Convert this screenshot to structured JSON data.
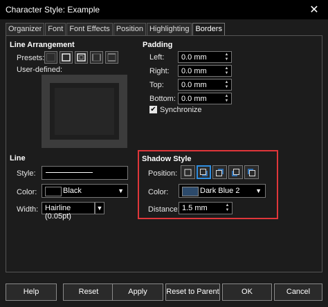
{
  "window": {
    "title": "Character Style: Example",
    "close_glyph": "✕"
  },
  "tabs": [
    "Organizer",
    "Font",
    "Font Effects",
    "Position",
    "Highlighting",
    "Borders"
  ],
  "line_arrangement": {
    "heading": "Line Arrangement",
    "presets_label": "Presets:",
    "user_defined_label": "User-defined:"
  },
  "padding": {
    "heading": "Padding",
    "left_label": "Left:",
    "left_value": "0.0 mm",
    "right_label": "Right:",
    "right_value": "0.0 mm",
    "top_label": "Top:",
    "top_value": "0.0 mm",
    "bottom_label": "Bottom:",
    "bottom_value": "0.0 mm",
    "sync_label": "Synchronize",
    "sync_checked": true
  },
  "line": {
    "heading": "Line",
    "style_label": "Style:",
    "color_label": "Color:",
    "color_value": "Black",
    "width_label": "Width:",
    "width_value": "Hairline (0.05pt)"
  },
  "shadow": {
    "heading": "Shadow Style",
    "position_label": "Position:",
    "color_label": "Color:",
    "color_value": "Dark Blue 2",
    "color_swatch": "#2c4a6b",
    "distance_label": "Distance:",
    "distance_value": "1.5 mm",
    "highlight_color": "#e0363a",
    "selected_color": "#2f8ee0"
  },
  "buttons": {
    "help": "Help",
    "reset": "Reset",
    "apply": "Apply",
    "reset_parent": "Reset to Parent",
    "ok": "OK",
    "cancel": "Cancel"
  }
}
